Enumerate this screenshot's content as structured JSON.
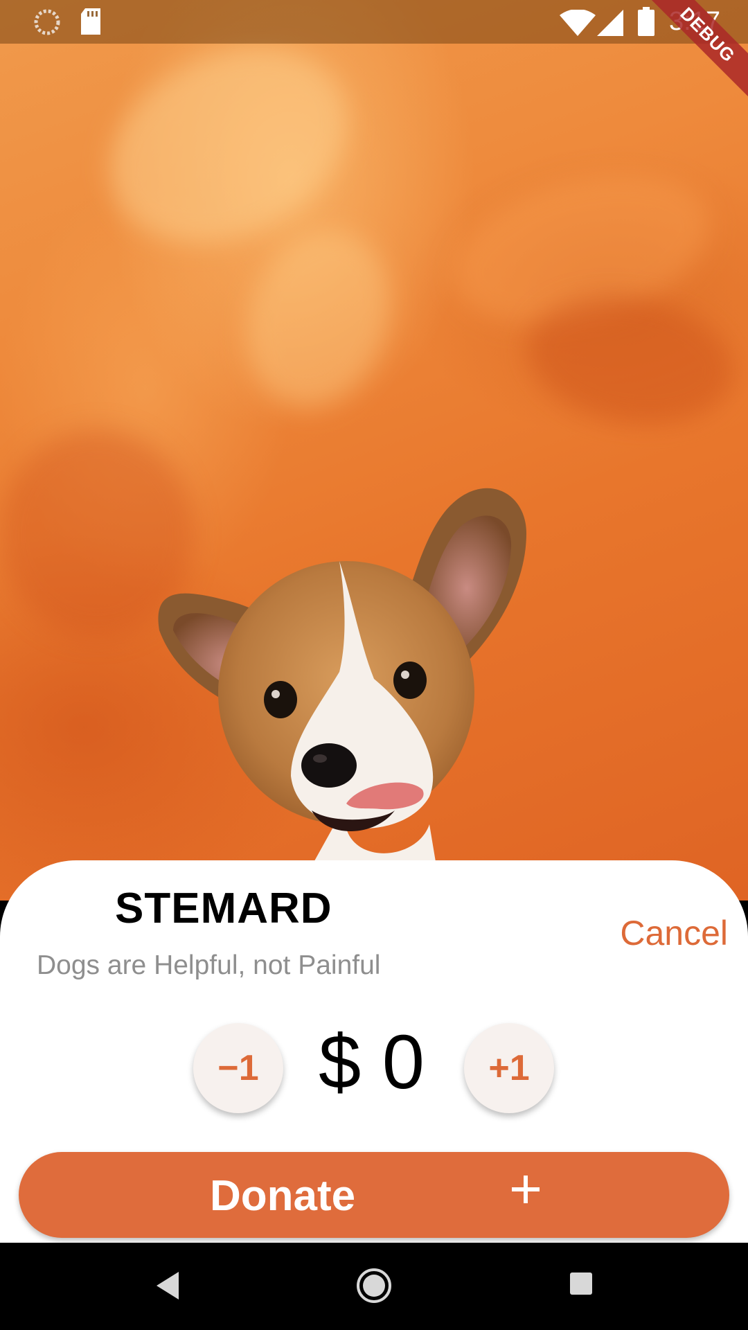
{
  "status_bar": {
    "time": "3:17",
    "debug_label": "DEBUG",
    "icons": [
      "loading-icon",
      "sd-card-icon",
      "wifi-icon",
      "signal-icon",
      "battery-icon"
    ]
  },
  "hero": {
    "image": "corgi-puppy-photo"
  },
  "sheet": {
    "title": "STEMARD",
    "subtitle": "Dogs are Helpful, not Painful",
    "cancel_label": "Cancel",
    "decrement_label": "−1",
    "increment_label": "+1",
    "amount": "$ 0",
    "donate_label": "Donate",
    "donate_icon": "plus-icon"
  },
  "nav_bar": {
    "icons": [
      "back-icon",
      "home-icon",
      "recents-icon"
    ]
  },
  "colors": {
    "accent": "#DF6C3C",
    "stepper_bg": "#F7F1EE",
    "subtitle": "#8E8E8E"
  }
}
